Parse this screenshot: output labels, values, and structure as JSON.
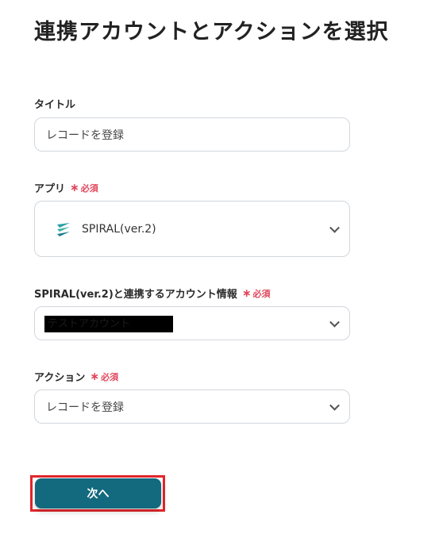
{
  "page": {
    "title": "連携アカウントとアクションを選択"
  },
  "required_label": "必須",
  "title_field": {
    "label": "タイトル",
    "value": "レコードを登録"
  },
  "app_field": {
    "label": "アプリ",
    "app_name": "SPIRAL(ver.2)",
    "icon": "spiral-logo-icon"
  },
  "account_field": {
    "label": "SPIRAL(ver.2)と連携するアカウント情報",
    "value": "テストアカウント"
  },
  "action_field": {
    "label": "アクション",
    "value": "レコードを登録"
  },
  "next_button": {
    "label": "次へ"
  },
  "colors": {
    "accent": "#13697d",
    "required": "#e0475c",
    "highlight": "#e3262b"
  }
}
